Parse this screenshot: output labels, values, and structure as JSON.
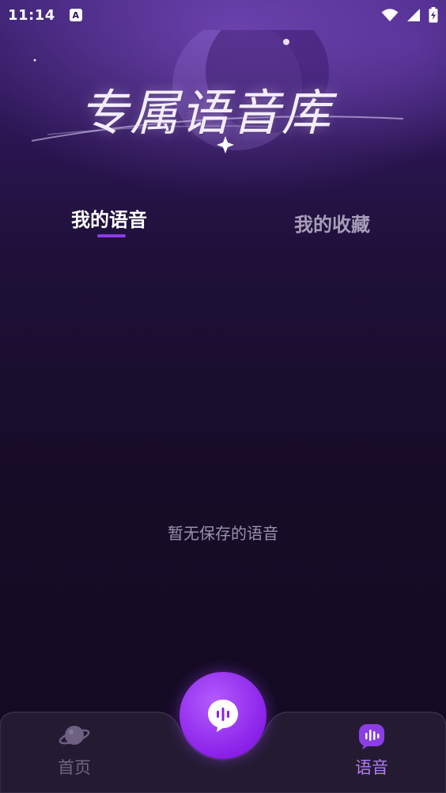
{
  "status_bar": {
    "time": "11:14",
    "app_badge": "A",
    "icons": [
      "wifi-icon",
      "cellular-signal-icon",
      "battery-charging-icon"
    ]
  },
  "banner": {
    "title": "专属语音库"
  },
  "tabs": [
    {
      "label": "我的语音",
      "active": true
    },
    {
      "label": "我的收藏",
      "active": false
    }
  ],
  "content": {
    "empty_text": "暂无保存的语音"
  },
  "bottom_nav": {
    "items": [
      {
        "label": "首页",
        "icon": "planet-icon",
        "active": false
      },
      {
        "label": "语音",
        "icon": "voice-wave-icon",
        "active": true
      }
    ],
    "center_button_icon": "voice-chat-icon"
  },
  "colors": {
    "accent": "#8e3be9",
    "active_nav": "#b07cf0",
    "inactive_text": "#a79db7"
  }
}
